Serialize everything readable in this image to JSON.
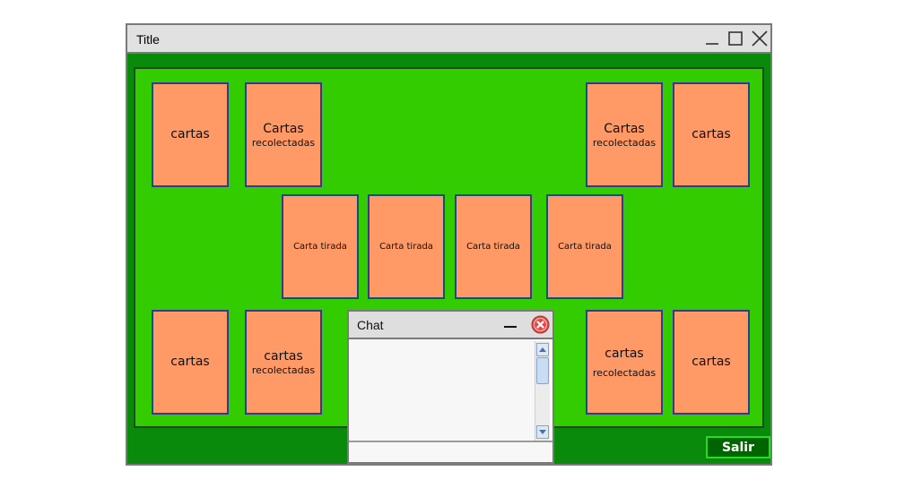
{
  "window": {
    "title": "Title"
  },
  "board": {
    "cards": {
      "top_left_deck": "cartas",
      "top_left_collected": {
        "line1": "Cartas",
        "line2": "recolectadas"
      },
      "top_right_collected": {
        "line1": "Cartas",
        "line2": "recolectadas"
      },
      "top_right_deck": "cartas",
      "played": [
        "Carta tirada",
        "Carta tirada",
        "Carta tirada",
        "Carta tirada"
      ],
      "bottom_left_deck": "cartas",
      "bottom_left_collected": {
        "line1": "cartas",
        "line2": "recolectadas"
      },
      "bottom_right_collected": {
        "line1": "cartas",
        "line2": "recolectadas"
      },
      "bottom_right_deck": "cartas"
    },
    "exit_label": "Salir"
  },
  "chat": {
    "title": "Chat",
    "message_text": "",
    "input_value": ""
  },
  "colors": {
    "table": "#33cc00",
    "card": "#ff9966",
    "frame": "#0a8a0a",
    "card_border": "#2a3f8f"
  }
}
